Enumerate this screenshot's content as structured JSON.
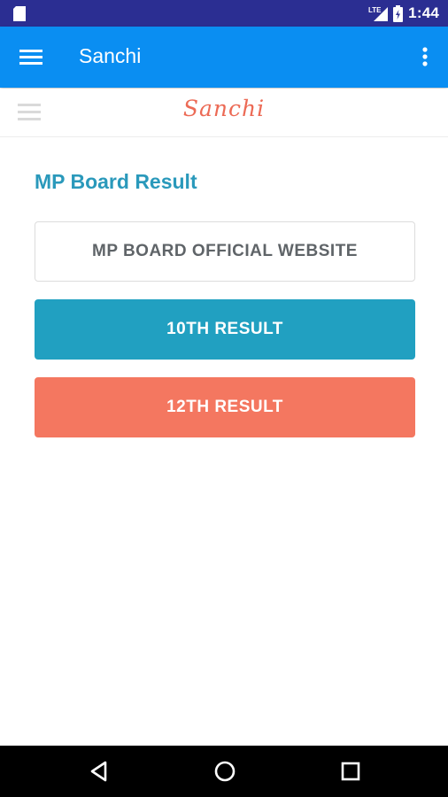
{
  "status_bar": {
    "network": "LTE",
    "time": "1:44"
  },
  "app_bar": {
    "title": "Sanchi",
    "menu_icon": "hamburger-menu-icon",
    "overflow_icon": "more-vertical-icon"
  },
  "web_header": {
    "logo_text": "Sanchi",
    "menu_icon": "hamburger-menu-icon"
  },
  "main": {
    "section_title": "MP Board Result",
    "buttons": [
      {
        "label": "MP BOARD OFFICIAL WEBSITE",
        "style": "outline"
      },
      {
        "label": "10TH RESULT",
        "style": "teal"
      },
      {
        "label": "12TH RESULT",
        "style": "coral"
      }
    ]
  },
  "nav_bar": {
    "back_icon": "back-triangle-icon",
    "home_icon": "home-circle-icon",
    "recents_icon": "recents-square-icon"
  },
  "colors": {
    "status_bar": "#2b2e92",
    "app_bar": "#0a8ef2",
    "logo": "#ec6a55",
    "section_title": "#2a99bb",
    "teal_button": "#21a0c1",
    "coral_button": "#f47760"
  }
}
